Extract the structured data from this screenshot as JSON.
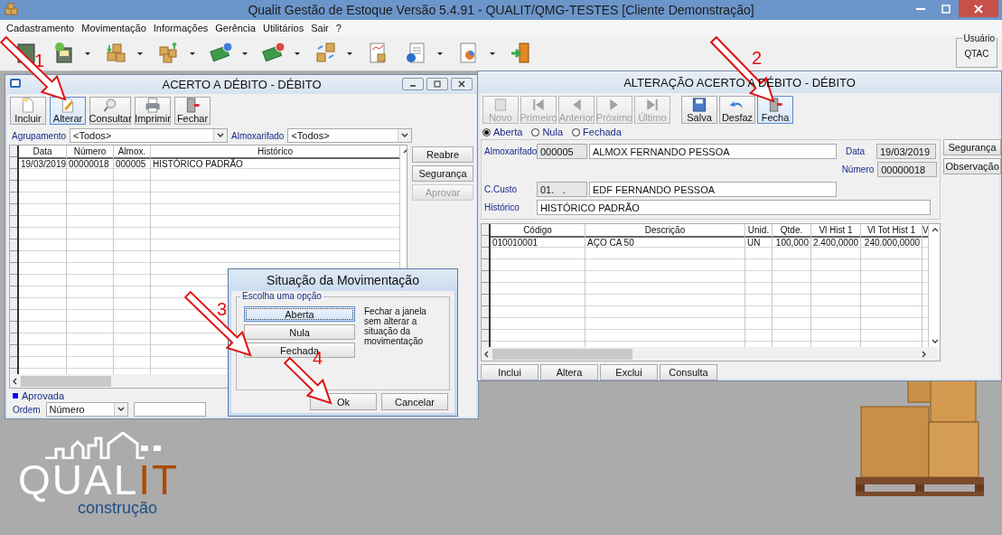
{
  "app": {
    "title": "Qualit Gestão de Estoque Versão 5.4.91 - QUALIT/QMG-TESTES [Cliente Demonstração]",
    "menu": [
      "Cadastramento",
      "Movimentação",
      "Informações",
      "Gerência",
      "Utilitários",
      "Sair",
      "?"
    ],
    "user": {
      "label": "Usuário",
      "value": "QTAC"
    }
  },
  "list_window": {
    "title": "ACERTO A DÉBITO - DÉBITO",
    "toolbar": [
      {
        "label": "Incluir",
        "selected": false
      },
      {
        "label": "Alterar",
        "selected": true
      },
      {
        "label": "Consultar",
        "selected": false
      },
      {
        "label": "Imprimir",
        "selected": false
      },
      {
        "label": "Fechar",
        "selected": false
      }
    ],
    "filters": [
      {
        "label": "Agrupamento",
        "value": "<Todos>"
      },
      {
        "label": "Almoxarifado",
        "value": "<Todos>"
      }
    ],
    "table": {
      "columns": [
        "Data",
        "Número",
        "Almox.",
        "Histórico"
      ],
      "rows": [
        [
          "19/03/2019",
          "00000018",
          "000005",
          "HISTÓRICO PADRÃO"
        ]
      ]
    },
    "side_buttons": [
      {
        "label": "Reabre",
        "disabled": false
      },
      {
        "label": "Segurança",
        "disabled": false
      },
      {
        "label": "Aprovar",
        "disabled": true
      }
    ],
    "legend": {
      "label": "Aprovada",
      "color": "#0000ff"
    },
    "order": {
      "label": "Ordem",
      "value": "Número"
    }
  },
  "edit_window": {
    "title": "ALTERAÇÃO ACERTO A DÉBITO - DÉBITO",
    "toolbar": [
      {
        "label": "Novo",
        "disabled": true,
        "selected": false
      },
      {
        "label": "Primeiro",
        "disabled": true,
        "selected": false
      },
      {
        "label": "Anterior",
        "disabled": true,
        "selected": false
      },
      {
        "label": "Próximo",
        "disabled": true,
        "selected": false
      },
      {
        "label": "Último",
        "disabled": true,
        "selected": false
      },
      {
        "label": "Salva",
        "disabled": false,
        "selected": false
      },
      {
        "label": "Desfaz",
        "disabled": false,
        "selected": false
      },
      {
        "label": "Fecha",
        "disabled": false,
        "selected": true
      }
    ],
    "status_options": [
      {
        "label": "Aberta",
        "selected": true
      },
      {
        "label": "Nula",
        "selected": false
      },
      {
        "label": "Fechada",
        "selected": false
      }
    ],
    "almoxarifado": {
      "label": "Almoxarifado",
      "code": "000005",
      "name": "ALMOX FERNANDO PESSOA"
    },
    "data": {
      "label": "Data",
      "value": "19/03/2019"
    },
    "numero": {
      "label": "Número",
      "value": "00000018"
    },
    "centro_custo": {
      "label": "C.Custo",
      "code": "01.   .",
      "name": "EDF FERNANDO PESSOA"
    },
    "historico": {
      "label": "Histórico",
      "value": "HISTÓRICO PADRÃO"
    },
    "side_buttons": [
      "Segurança",
      "Observação"
    ],
    "table": {
      "columns": [
        "Código",
        "Descrição",
        "Unid.",
        "Qtde.",
        "Vl Hist 1",
        "Vl Tot Hist 1",
        "V"
      ],
      "rows": [
        [
          "010010001",
          "AÇO CA 50",
          "UN",
          "100,000",
          "2.400,0000",
          "240.000,0000"
        ]
      ]
    },
    "buttons": [
      "Inclui",
      "Altera",
      "Exclui",
      "Consulta"
    ]
  },
  "dialog": {
    "title": "Situação da Movimentação",
    "group": "Escolha uma opção",
    "options": [
      {
        "label": "Aberta",
        "selected": true
      },
      {
        "label": "Nula",
        "selected": false
      },
      {
        "label": "Fechada",
        "selected": false
      }
    ],
    "hint": "Fechar a janela sem alterar a situação da movimentação",
    "buttons": [
      "Ok",
      "Cancelar"
    ]
  },
  "annotations": [
    {
      "label": "1"
    },
    {
      "label": "2"
    },
    {
      "label": "3"
    },
    {
      "label": "4"
    }
  ],
  "logo": {
    "brand": "QUAL",
    "brand_accent": "IT",
    "tagline": "construção"
  }
}
